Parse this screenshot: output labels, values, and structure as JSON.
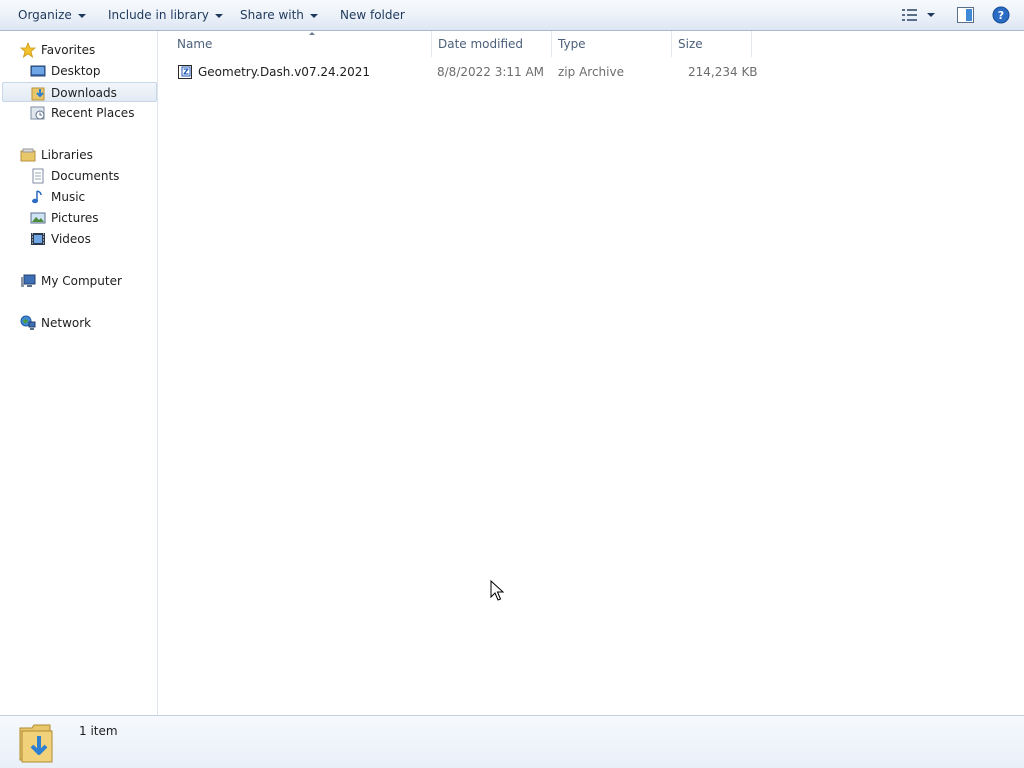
{
  "toolbar": {
    "organize": "Organize",
    "include_in_library": "Include in library",
    "share_with": "Share with",
    "new_folder": "New folder"
  },
  "sidebar": {
    "favorites": {
      "label": "Favorites",
      "items": [
        {
          "label": "Desktop",
          "icon": "desktop-icon"
        },
        {
          "label": "Downloads",
          "icon": "downloads-folder-icon",
          "selected": true
        },
        {
          "label": "Recent Places",
          "icon": "recent-places-icon"
        }
      ]
    },
    "libraries": {
      "label": "Libraries",
      "items": [
        {
          "label": "Documents",
          "icon": "documents-icon"
        },
        {
          "label": "Music",
          "icon": "music-icon"
        },
        {
          "label": "Pictures",
          "icon": "pictures-icon"
        },
        {
          "label": "Videos",
          "icon": "videos-icon"
        }
      ]
    },
    "computer": {
      "label": "My Computer"
    },
    "network": {
      "label": "Network"
    }
  },
  "table": {
    "columns": [
      "Name",
      "Date modified",
      "Type",
      "Size"
    ],
    "rows": [
      {
        "name": "Geometry.Dash.v07.24.2021",
        "date_modified": "8/8/2022 3:11 AM",
        "type": "zip Archive",
        "size": "214,234 KB",
        "icon": "zip-archive-icon"
      }
    ]
  },
  "status": {
    "item_count": "1 item"
  },
  "colors": {
    "accent": "#1e395b",
    "selection": "#e2eaf4",
    "toolbar": "#eef3fa"
  }
}
